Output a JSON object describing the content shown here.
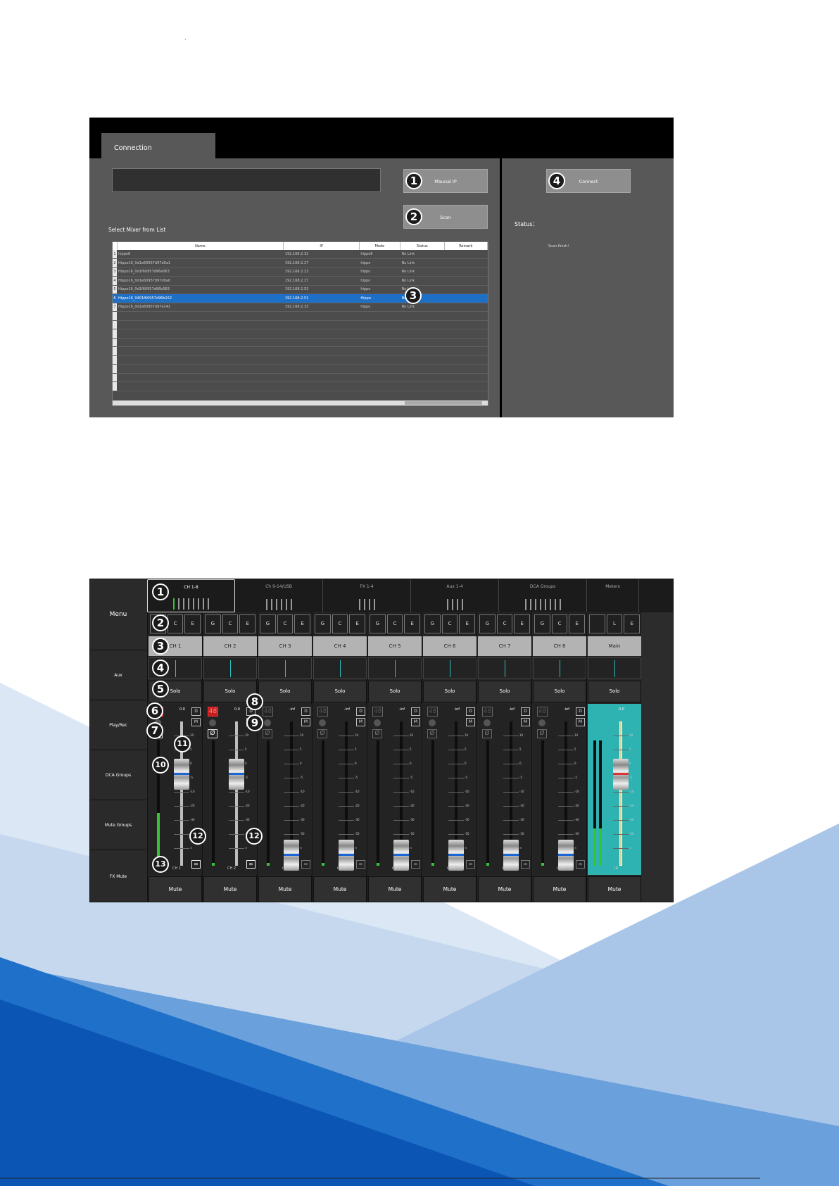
{
  "top_marker": "·",
  "connection": {
    "tab_label": "Connection",
    "manual_ip_button": "Maunal IP",
    "scan_button": "Scan",
    "connect_button": "Connect",
    "select_label": "Select Mixer from List",
    "status_label": "Status：",
    "status_value": "Scan finish!",
    "columns": [
      "Name",
      "IP",
      "Mode",
      "Status",
      "Remark"
    ],
    "rows": [
      {
        "idx": "1",
        "name": "hippo8",
        "ip": "192.168.2.32",
        "mode": "hippo8",
        "status": "No Link",
        "remark": ""
      },
      {
        "idx": "2",
        "name": "Hippo16_0d1e60957d97d0a1",
        "ip": "192.168.2.27",
        "mode": "hippo",
        "status": "No Link",
        "remark": ""
      },
      {
        "idx": "3",
        "name": "Hippo16_0d1f60957d96a063",
        "ip": "192.168.2.23",
        "mode": "hippo",
        "status": "No Link",
        "remark": ""
      },
      {
        "idx": "4",
        "name": "Hippo16_0d1e60957d97d0a0",
        "ip": "192.168.2.27",
        "mode": "hippo",
        "status": "No Link",
        "remark": ""
      },
      {
        "idx": "5",
        "name": "Hippo16_0d1f60957d96b583",
        "ip": "192.168.2.52",
        "mode": "hippo",
        "status": "No Link",
        "remark": ""
      },
      {
        "idx": "6",
        "name": "Hippo16_0401f60957d96b152",
        "ip": "192.168.2.51",
        "mode": "Hippo",
        "status": "No Link",
        "remark": "",
        "selected": true
      },
      {
        "idx": "7",
        "name": "Hippo16_0d1e60957d97e141",
        "ip": "192.168.2.33",
        "mode": "hippo",
        "status": "No Link",
        "remark": ""
      }
    ],
    "badges": [
      "1",
      "2",
      "3",
      "4"
    ]
  },
  "mixer": {
    "menu_items": [
      "Menu",
      "Aux",
      "Play/Rec",
      "DCA Groups",
      "Mute Groups",
      "FX Mute"
    ],
    "tabs": [
      "CH 1-8",
      "Ch 9-14/USB",
      "FX 1-4",
      "Aux 1-4",
      "DCA Groups",
      "Meters"
    ],
    "g_label": "G",
    "c_label": "C",
    "e_label": "E",
    "l_label": "L",
    "solo_label": "Solo",
    "mute_label": "Mute",
    "p48_label": "48",
    "phase_label": "Ø",
    "d_label": "D",
    "m_label": "M",
    "link_label": "∞",
    "scale": [
      "10",
      "5",
      "0",
      "-5",
      "-10",
      "-20",
      "-30",
      "-50",
      "∞"
    ],
    "channels": [
      {
        "name": "CH 1",
        "label": "CH 1",
        "gain": "0.0",
        "p48": true,
        "phase": true,
        "link": true,
        "fader": 0.72,
        "meter": 0.42
      },
      {
        "name": "CH 2",
        "label": "CH 2",
        "gain": "0.0",
        "p48": true,
        "phase": true,
        "link": true,
        "fader": 0.72,
        "meter": 0.02
      },
      {
        "name": "CH 3",
        "label": "CH 3",
        "gain": "-inf",
        "p48": false,
        "phase": false,
        "link": false,
        "fader": 0.0,
        "meter": 0.02
      },
      {
        "name": "CH 4",
        "label": "CH 4",
        "gain": "-inf",
        "p48": false,
        "phase": false,
        "link": false,
        "fader": 0.0,
        "meter": 0.02
      },
      {
        "name": "CH 5",
        "label": "CH 5",
        "gain": "-inf",
        "p48": false,
        "phase": false,
        "link": false,
        "fader": 0.0,
        "meter": 0.02
      },
      {
        "name": "CH 6",
        "label": "CH 6",
        "gain": "-inf",
        "p48": false,
        "phase": false,
        "link": false,
        "fader": 0.0,
        "meter": 0.02
      },
      {
        "name": "CH 7",
        "label": "CH 7",
        "gain": "-inf",
        "p48": false,
        "phase": false,
        "link": false,
        "fader": 0.0,
        "meter": 0.02
      },
      {
        "name": "CH 8",
        "label": "CH 8",
        "gain": "-inf",
        "p48": false,
        "phase": false,
        "link": false,
        "fader": 0.0,
        "meter": 0.02
      }
    ],
    "main": {
      "name": "Main",
      "label": "LR",
      "gain": "0.0",
      "fader": 0.72,
      "meter": 0.3
    },
    "badges": [
      "1",
      "2",
      "3",
      "4",
      "5",
      "6",
      "7",
      "8",
      "9",
      "10",
      "11",
      "12",
      "13"
    ]
  },
  "colors": {
    "accent_blue": "#1e6fc6",
    "p48_red": "#c41e1e",
    "meter_green": "#36c33a",
    "main_teal": "#2eb2b2"
  }
}
